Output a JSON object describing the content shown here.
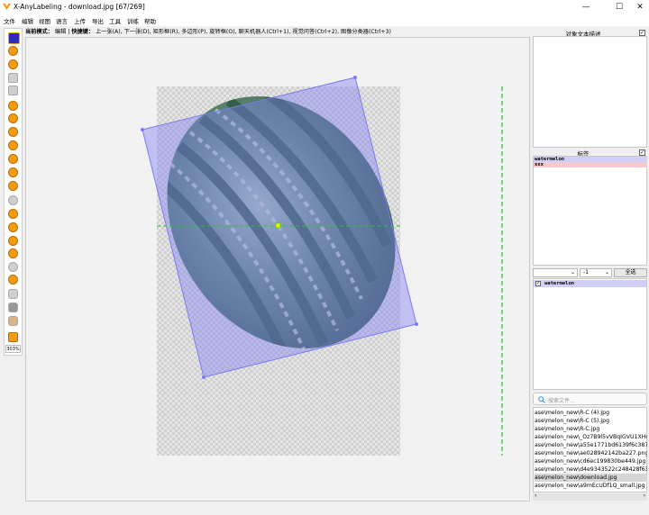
{
  "window": {
    "title": "X-AnyLabeling - download.jpg [67/269]",
    "controls": [
      "—",
      "☐",
      "✕"
    ]
  },
  "menu": [
    "文件",
    "编辑",
    "视图",
    "语言",
    "上传",
    "导出",
    "工具",
    "训练",
    "帮助"
  ],
  "mode_bar": {
    "mode_label": "当前模式：",
    "mode_value": "编辑",
    "shortcut_label": "快捷键：",
    "shortcuts": "上一张(A), 下一张(D), 矩形框(R), 多边形(P), 旋转框(O), 聊天机器人(Ctrl+1), 视觉问答(Ctrl+2), 图像分类器(Ctrl+3)"
  },
  "toolbar": {
    "zoom": "303%"
  },
  "right_panel": {
    "description_title": "对象文本描述",
    "labels_title": "标签",
    "labels": [
      {
        "text": "watermelon",
        "bg": "#cfcff8"
      },
      {
        "text": "xxx",
        "bg": "#f4c9d0"
      }
    ],
    "group_value": "-1",
    "select_all": "全选",
    "shapes": [
      {
        "text": "watermelon",
        "checked": true
      }
    ],
    "search_placeholder": "搜索文件...",
    "files": [
      "ase\\melon_new\\R-C (4).jpg",
      "ase\\melon_new\\R-C (5).jpg",
      "ase\\melon_new\\R-C.jpg",
      "ase\\melon_new\\_Oz7B9l5vVBqIGVU1XHc",
      "ase\\melon_new\\a55e1771bd6139f6c387c",
      "ase\\melon_new\\ae028942142ba227.png",
      "ase\\melon_new\\cd6ec199830be449.jpg",
      "ase\\melon_new\\d4e9343522c248428f63c",
      "ase\\melon_new\\download.jpg",
      "ase\\melon_new\\a9mEcUDf1Q_small.jpg"
    ],
    "selected_file_index": 8
  },
  "colors": {
    "accent": "#f39c12",
    "shape_fill": "#7b7bf3",
    "guide": "#28c828"
  }
}
